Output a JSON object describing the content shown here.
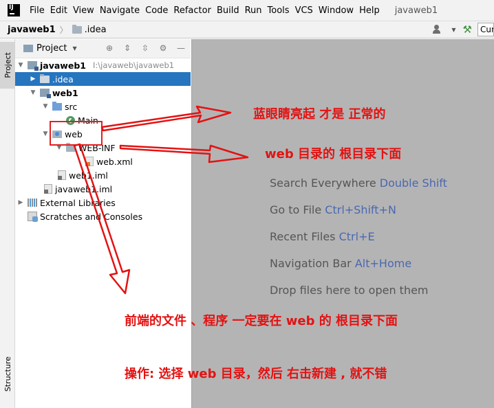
{
  "menubar": {
    "logo": "IJ",
    "items": [
      "File",
      "Edit",
      "View",
      "Navigate",
      "Code",
      "Refactor",
      "Build",
      "Run",
      "Tools",
      "VCS",
      "Window",
      "Help"
    ],
    "project_name": "javaweb1"
  },
  "navbar": {
    "root": "javaweb1",
    "crumb": ".idea",
    "run_config": "Cur"
  },
  "left_strip": {
    "project_tab": "Project",
    "structure_tab": "Structure"
  },
  "panel": {
    "title": "Project"
  },
  "tree": [
    {
      "label": "javaweb1",
      "hint": "I:\\javaweb\\javaweb1",
      "bold": true
    },
    {
      "label": ".idea"
    },
    {
      "label": "web1",
      "bold": true
    },
    {
      "label": "src"
    },
    {
      "label": "Main"
    },
    {
      "label": "web"
    },
    {
      "label": "WEB-INF"
    },
    {
      "label": "web.xml"
    },
    {
      "label": "web1.iml"
    },
    {
      "label": "javaweb1.iml"
    },
    {
      "label": "External Libraries"
    },
    {
      "label": "Scratches and Consoles"
    }
  ],
  "editor_hints": [
    {
      "text": "Search Everywhere",
      "shortcut": "Double Shift"
    },
    {
      "text": "Go to File",
      "shortcut": "Ctrl+Shift+N"
    },
    {
      "text": "Recent Files",
      "shortcut": "Ctrl+E"
    },
    {
      "text": "Navigation Bar",
      "shortcut": "Alt+Home"
    },
    {
      "text": "Drop files here to open them",
      "shortcut": ""
    }
  ],
  "annotations": {
    "a1": "蓝眼睛亮起  才是  正常的",
    "a2": "web   目录的 根目录下面",
    "a3": "前端的文件 、程序  一定要在  web  的  根目录下面",
    "a4": "操作:   选择  web  目录，然后  右击新建 ,  就不错"
  },
  "colors": {
    "selection": "#2675bf",
    "annotation": "#e31212",
    "shortcut": "#4a68b0"
  }
}
